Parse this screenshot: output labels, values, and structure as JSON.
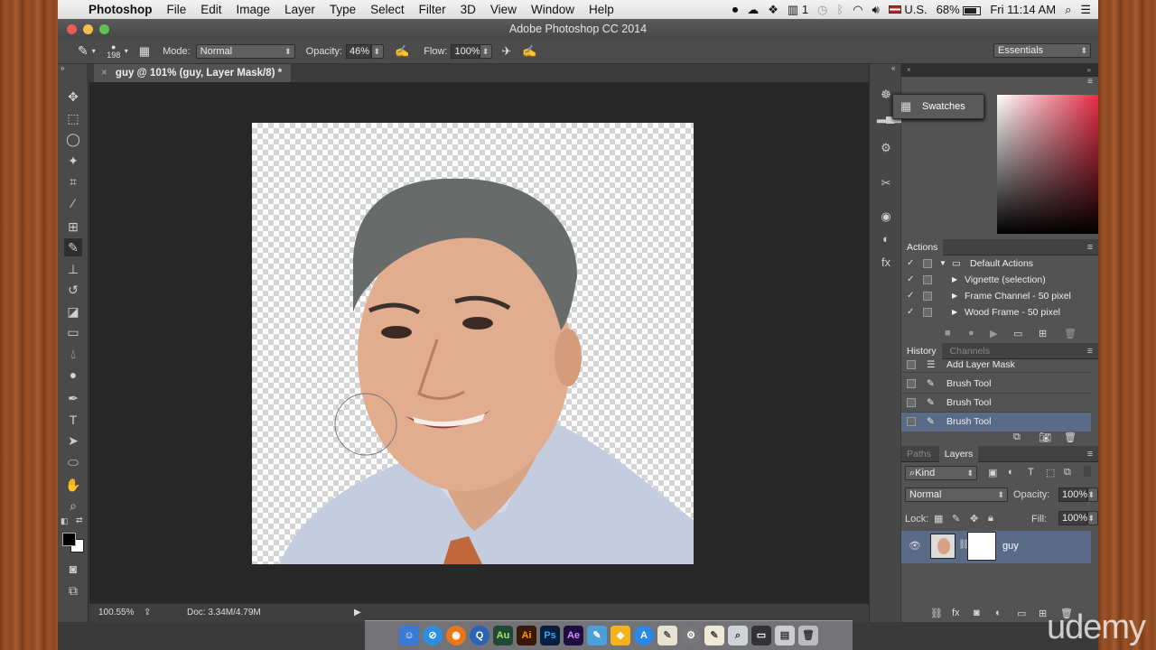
{
  "menubar": {
    "app": "Photoshop",
    "items": [
      "File",
      "Edit",
      "Image",
      "Layer",
      "Type",
      "Select",
      "Filter",
      "3D",
      "View",
      "Window",
      "Help"
    ],
    "status_count": "1",
    "input_source": "U.S.",
    "battery": "68%",
    "clock": "Fri 11:14 AM"
  },
  "window": {
    "title": "Adobe Photoshop CC 2014"
  },
  "options": {
    "brush_size": "198",
    "mode_label": "Mode:",
    "mode_value": "Normal",
    "opacity_label": "Opacity:",
    "opacity_value": "46%",
    "flow_label": "Flow:",
    "flow_value": "100%",
    "workspace": "Essentials"
  },
  "document": {
    "tab_title": "guy @ 101% (guy, Layer Mask/8) *",
    "zoom": "100.55%",
    "doc_size": "Doc: 3.34M/4.79M"
  },
  "swatches_tab": "Swatches",
  "actions": {
    "title": "Actions",
    "items": [
      "Default Actions",
      "Vignette (selection)",
      "Frame Channel - 50 pixel",
      "Wood Frame - 50 pixel"
    ]
  },
  "history": {
    "tabs": [
      "History",
      "Channels"
    ],
    "items": [
      "Add Layer Mask",
      "Brush Tool",
      "Brush Tool",
      "Brush Tool"
    ]
  },
  "layers": {
    "tabs": [
      "Paths",
      "Layers"
    ],
    "filter": "Kind",
    "blend": "Normal",
    "opacity_label": "Opacity:",
    "opacity_value": "100%",
    "lock_label": "Lock:",
    "fill_label": "Fill:",
    "fill_value": "100%",
    "layer_name": "guy"
  },
  "watermark": "udemy",
  "colors": {
    "accent_selected": "#5a6b87",
    "panel": "#535353",
    "bg": "#282828"
  }
}
